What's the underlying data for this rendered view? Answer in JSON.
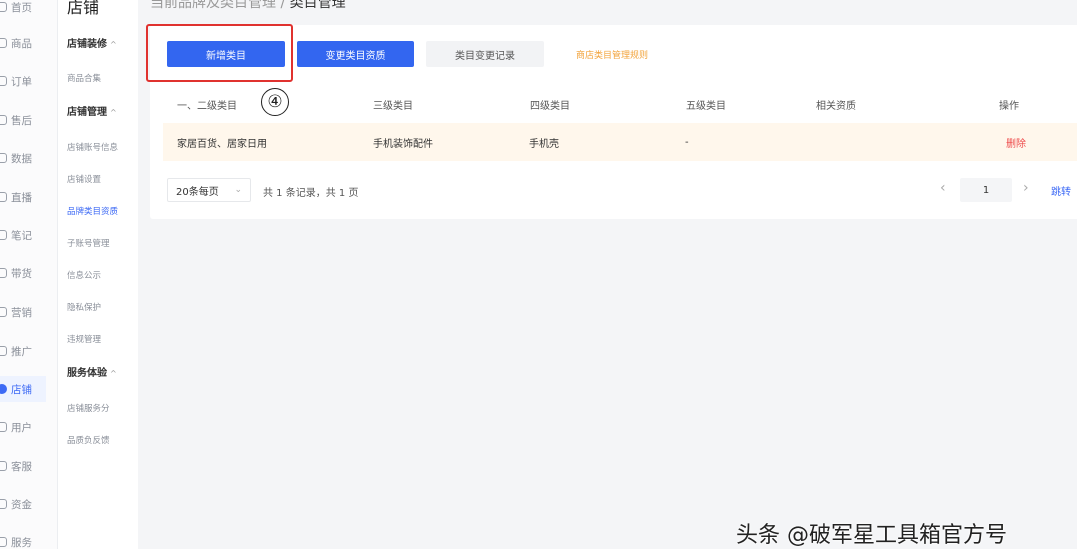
{
  "nav": {
    "items": [
      {
        "label": "首页"
      },
      {
        "label": "商品"
      },
      {
        "label": "订单"
      },
      {
        "label": "售后"
      },
      {
        "label": "数据"
      },
      {
        "label": "直播"
      },
      {
        "label": "笔记"
      },
      {
        "label": "带货"
      },
      {
        "label": "营销"
      },
      {
        "label": "推广"
      },
      {
        "label": "店铺"
      },
      {
        "label": "用户"
      },
      {
        "label": "客服"
      },
      {
        "label": "资金"
      },
      {
        "label": "服务"
      }
    ],
    "active_index": 10
  },
  "subnav": {
    "title": "店铺",
    "groups": [
      {
        "heading": "店铺装修",
        "links": [
          "商品合集"
        ]
      },
      {
        "heading": "店铺管理",
        "links": [
          "店铺账号信息",
          "店铺设置",
          "品牌类目资质",
          "子账号管理",
          "信息公示",
          "隐私保护",
          "违规管理"
        ]
      },
      {
        "heading": "服务体验",
        "links": [
          "店铺服务分",
          "品质负反馈"
        ]
      }
    ],
    "active_link": "品牌类目资质"
  },
  "breadcrumb": {
    "parent": "当前品牌及类目管理 / ",
    "current": "类目管理"
  },
  "toolbar": {
    "add_category": "新增类目",
    "change_qualification": "变更类目资质",
    "change_log": "类目变更记录",
    "rules_link": "商店类目管理规则"
  },
  "table": {
    "columns": [
      "一、二级类目",
      "三级类目",
      "四级类目",
      "五级类目",
      "相关资质",
      "操作"
    ],
    "rows": [
      {
        "lvl12": "家居百货、居家日用",
        "lvl3": "手机装饰配件",
        "lvl4": "手机壳",
        "lvl5": "-",
        "qualification": "",
        "action": "删除"
      }
    ]
  },
  "pagination": {
    "page_size": "20条每页",
    "summary": "共 1 条记录，共 1 页",
    "current_page": "1",
    "jump": "跳转"
  },
  "annotation": {
    "step": "④"
  },
  "watermark": "头条 @破军星工具箱官方号",
  "colors": {
    "primary": "#3366f0",
    "highlight": "#e0322f",
    "warning_link": "#f2a33a",
    "danger": "#ee4a4a"
  }
}
